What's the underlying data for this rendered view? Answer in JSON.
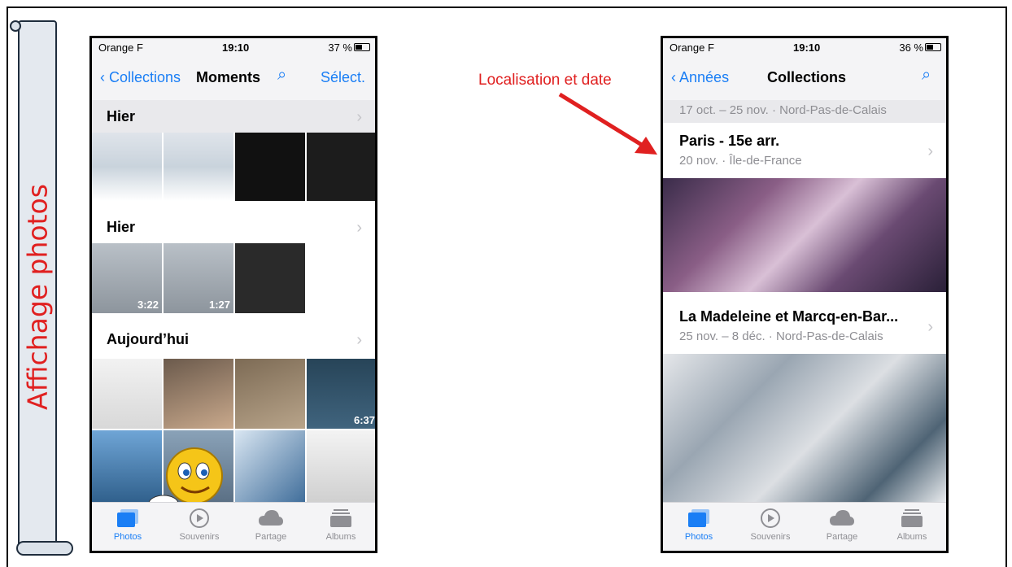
{
  "slide": {
    "banner_title": "Affichage photos",
    "annotation": "Localisation et date"
  },
  "left_phone": {
    "status": {
      "carrier": "Orange F",
      "time": "19:10",
      "battery": "37 %"
    },
    "nav": {
      "back": "Collections",
      "title": "Moments",
      "select": "Sélect."
    },
    "sections": [
      {
        "label": "Hier"
      },
      {
        "label": "Hier",
        "durations": [
          "3:22",
          "1:27"
        ]
      },
      {
        "label": "Aujourd’hui",
        "durations": [
          "6:37"
        ]
      }
    ],
    "tabs": [
      "Photos",
      "Souvenirs",
      "Partage",
      "Albums"
    ]
  },
  "right_phone": {
    "status": {
      "carrier": "Orange F",
      "time": "19:10",
      "battery": "36 %"
    },
    "nav": {
      "back": "Années",
      "title": "Collections"
    },
    "top_caption": "17 oct. – 25 nov. · Nord-Pas-de-Calais",
    "collections": [
      {
        "title": "Paris - 15e arr.",
        "subtitle": "20 nov. · Île-de-France"
      },
      {
        "title": "La Madeleine et Marcq-en-Bar...",
        "subtitle": "25 nov. – 8 déc. · Nord-Pas-de-Calais"
      }
    ],
    "tabs": [
      "Photos",
      "Souvenirs",
      "Partage",
      "Albums"
    ]
  },
  "colors": {
    "accent": "#1a7ef5",
    "annotation": "#e02020"
  }
}
